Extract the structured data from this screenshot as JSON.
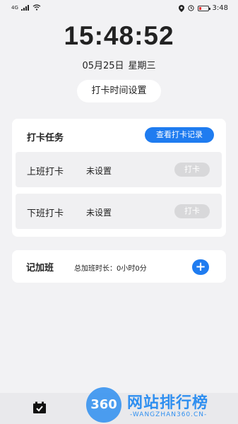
{
  "status_bar": {
    "signal": "4G",
    "time": "3:48"
  },
  "clock": {
    "time": "15:48:52",
    "date": "05月25日",
    "weekday": "星期三"
  },
  "set_time_button": "打卡时间设置",
  "task_card": {
    "title": "打卡任务",
    "record_button": "查看打卡记录",
    "rows": [
      {
        "label": "上班打卡",
        "status": "未设置",
        "button": "打卡"
      },
      {
        "label": "下班打卡",
        "status": "未设置",
        "button": "打卡"
      }
    ]
  },
  "overtime_card": {
    "title": "记加班",
    "total": "总加班时长：0小时0分",
    "add_icon": "plus-icon"
  },
  "bottom_nav": {
    "icon": "calendar-check-icon"
  },
  "watermark": {
    "badge": "360",
    "title": "网站排行榜",
    "subtitle": "-WANGZHAN360.CN-"
  },
  "colors": {
    "accent": "#1f7cf0",
    "background": "#f2f2f4",
    "disabled": "#d8d8da"
  }
}
